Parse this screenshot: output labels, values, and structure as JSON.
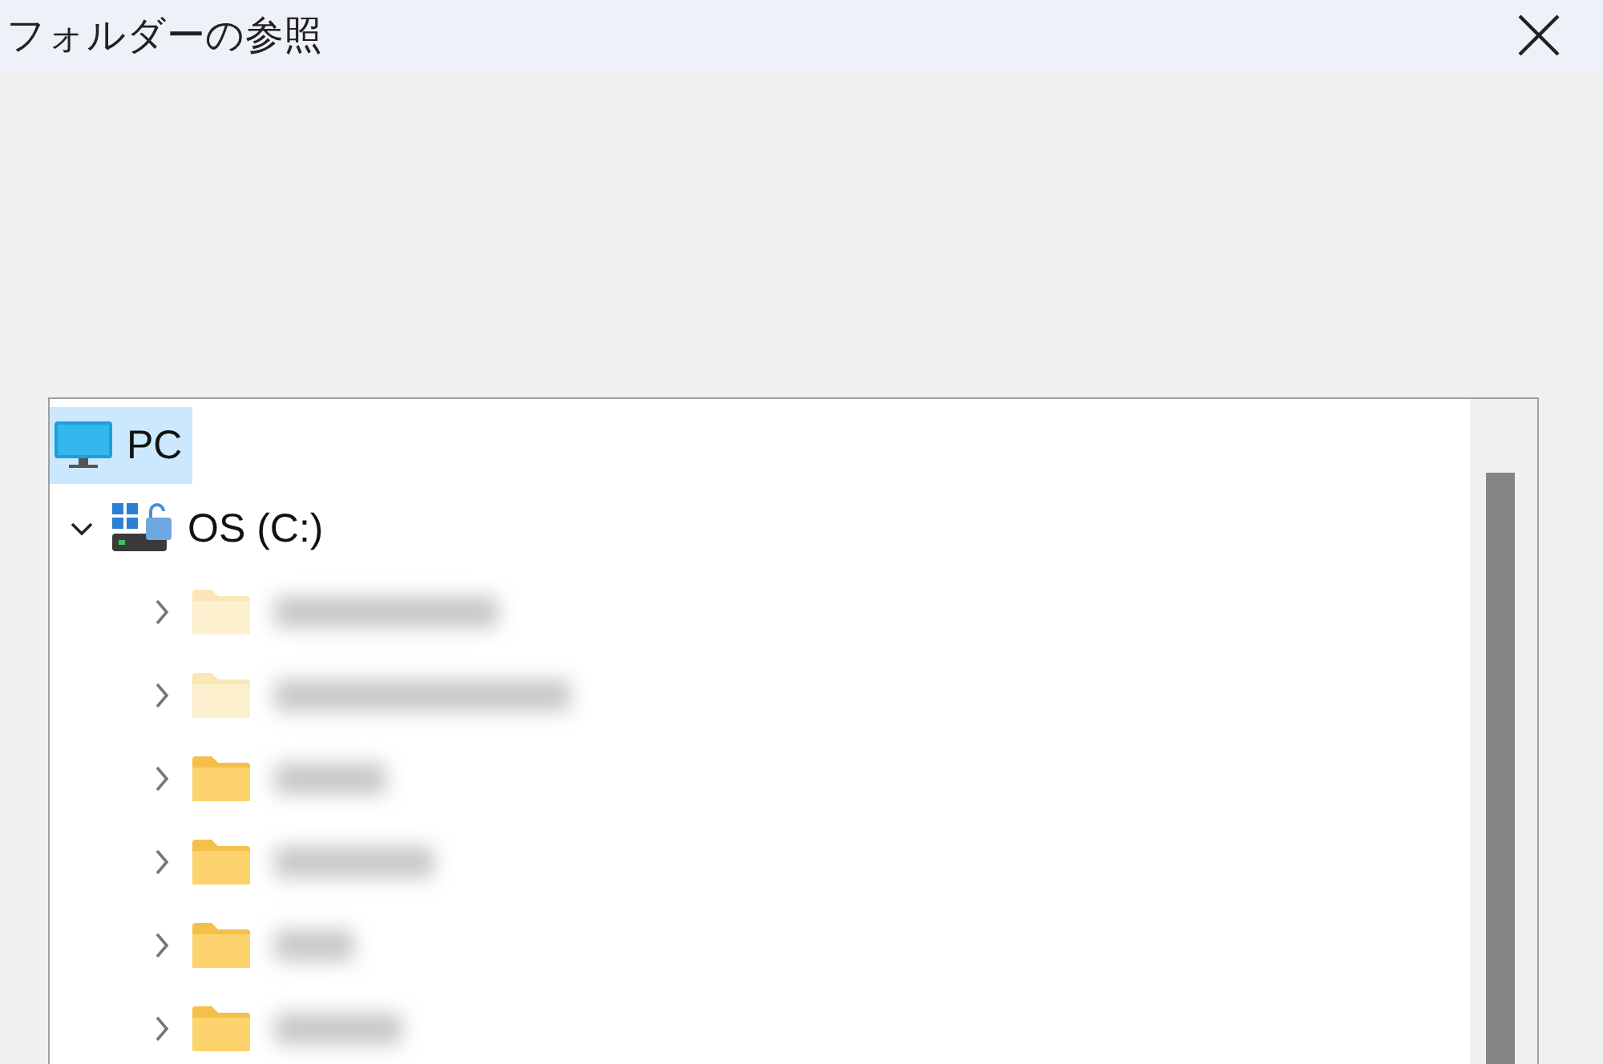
{
  "window": {
    "title": "フォルダーの参照"
  },
  "tree": [
    {
      "kind": "pc",
      "label": "PC",
      "selected": true,
      "children": [
        {
          "kind": "drive",
          "label": "OS (C:)",
          "expanded": true,
          "selected": false,
          "children": [
            {
              "kind": "folder",
              "hidden": true,
              "selected": false,
              "expanded": false
            },
            {
              "kind": "folder",
              "hidden": true,
              "selected": false,
              "expanded": false
            },
            {
              "kind": "folder",
              "hidden": false,
              "selected": false,
              "expanded": false
            },
            {
              "kind": "folder",
              "hidden": false,
              "selected": false,
              "expanded": false
            },
            {
              "kind": "folder",
              "hidden": false,
              "selected": false,
              "expanded": false
            },
            {
              "kind": "folder",
              "hidden": false,
              "selected": false,
              "expanded": false
            }
          ]
        }
      ]
    }
  ]
}
